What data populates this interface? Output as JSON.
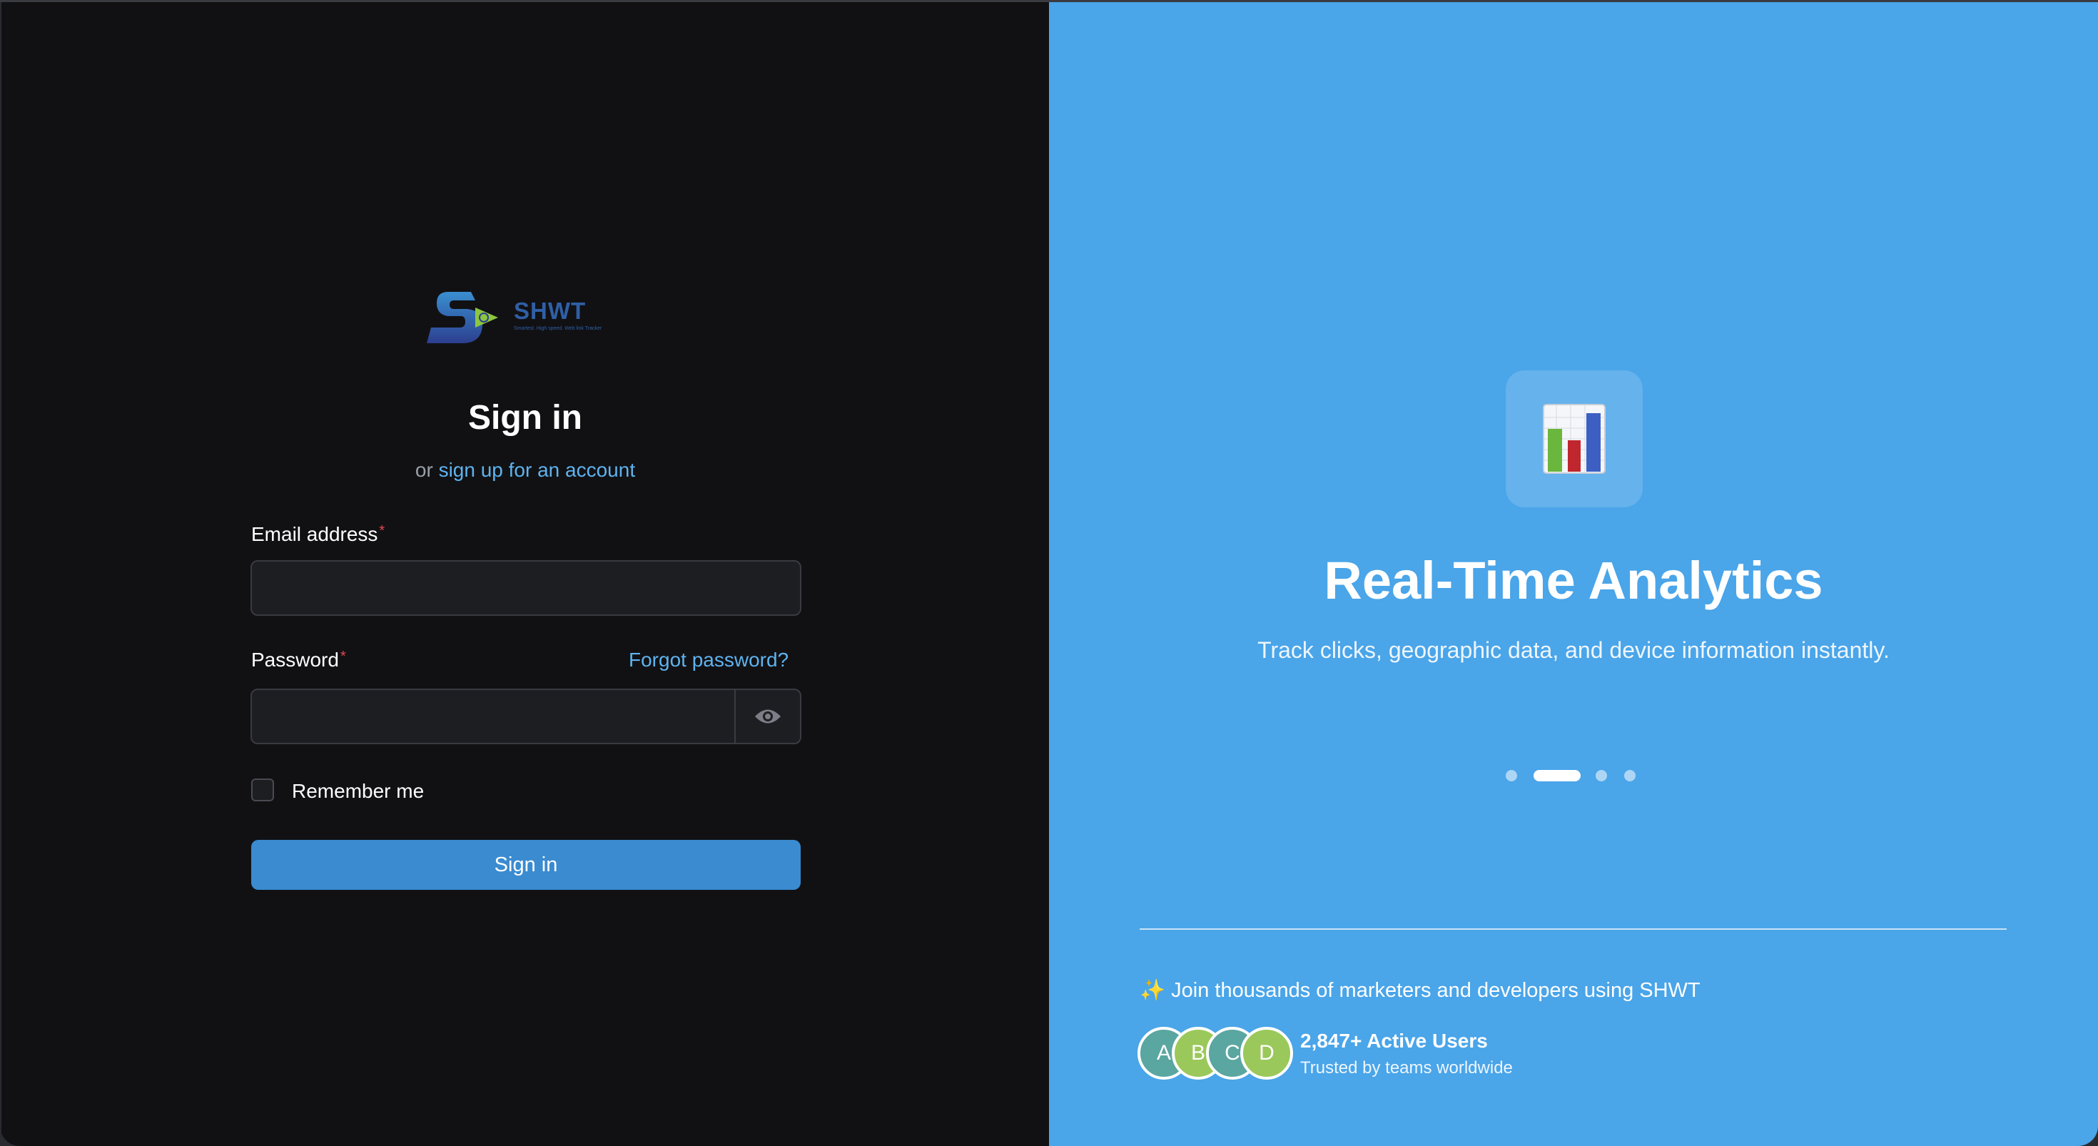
{
  "brand": {
    "name": "SHWT",
    "tagline": "Smartest. High speed. Web link Tracker",
    "logo_icon": "shwt-logo-icon"
  },
  "signin": {
    "title": "Sign in",
    "subtitle_prefix": "or",
    "signup_link": "sign up for an account",
    "email_label": "Email address",
    "email_value": "",
    "password_label": "Password",
    "password_value": "",
    "forgot_link": "Forgot password?",
    "remember_label": "Remember me",
    "remember_checked": false,
    "submit_label": "Sign in",
    "required_marker": "*",
    "eye_icon": "eye-icon"
  },
  "feature": {
    "icon": "bar-chart-icon",
    "title": "Real-Time Analytics",
    "description": "Track clicks, geographic data, and device information instantly.",
    "carousel_active_index": 1,
    "carousel_count": 4
  },
  "social_proof": {
    "join_text": "✨ Join thousands of marketers and developers using SHWT",
    "avatars": [
      "A",
      "B",
      "C",
      "D"
    ],
    "users_count": "2,847+ Active Users",
    "users_sub": "Trusted by teams worldwide"
  },
  "colors": {
    "left_bg": "#111114",
    "right_bg": "#4aa5e9",
    "accent": "#3a8bd0",
    "link": "#5fb3ee",
    "required": "#e5484d"
  }
}
